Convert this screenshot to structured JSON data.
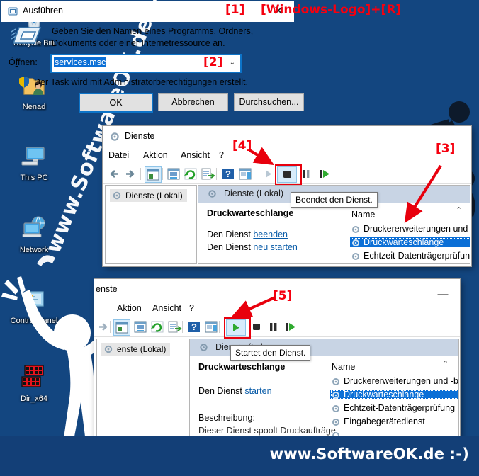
{
  "desktop": {
    "background_color": "#134680",
    "watermark": "www.SoftwareOK.de :-)",
    "icons": [
      {
        "name": "Recycle Bin",
        "icon": "recycle-bin-icon"
      },
      {
        "name": "Nenad",
        "icon": "user-folder-icon"
      },
      {
        "name": "This PC",
        "icon": "this-pc-icon"
      },
      {
        "name": "Network",
        "icon": "network-icon"
      },
      {
        "name": "Control Panel",
        "icon": "control-panel-icon"
      },
      {
        "name": "Dir_x64",
        "icon": "dir-x64-icon"
      }
    ]
  },
  "banner": {
    "url": "www.SoftwareOK.de :-)"
  },
  "steps": {
    "s1": "[1]",
    "s2": "[2]",
    "s3": "[3]",
    "s4": "[4]",
    "s5": "[5]"
  },
  "run_dialog": {
    "title": "Ausführen",
    "hint": "[Windows-Logo]+[R]",
    "description_line1": "Geben Sie den Namen eines Programms, Ordners,",
    "description_line2": "Dokuments oder einer Internetressource an.",
    "open_label": "Öffnen:",
    "open_value": "services.msc",
    "uac_text": "Der Task wird mit Administratorberechtigungen erstellt.",
    "buttons": {
      "ok": "OK",
      "cancel": "Abbrechen",
      "browse": "Durchsuchen..."
    },
    "close_glyph": "✕",
    "chevron_glyph": "⌄"
  },
  "services_top": {
    "title": "Dienste",
    "menu": [
      "Datei",
      "Aktion",
      "Ansicht",
      "?"
    ],
    "tree_node": "Dienste (Lokal)",
    "pane_header": "Dienste (Lokal)",
    "service_name": "Druckwarteschlange",
    "action_stop_prefix": "Den Dienst ",
    "action_stop_link": "beenden",
    "action_restart_prefix": "Den Dienst ",
    "action_restart_link": "neu starten",
    "tooltip": "Beendet den Dienst.",
    "column_name": "Name",
    "rows": [
      {
        "label": "Druckererweiterungen und -b",
        "selected": false
      },
      {
        "label": "Druckwarteschlange",
        "selected": true
      },
      {
        "label": "Echtzeit-Datenträgerprüfung",
        "selected": false
      }
    ],
    "toolbar_icons": [
      "back-icon",
      "forward-icon",
      "show-hide-tree-icon",
      "properties-icon",
      "refresh-icon",
      "export-list-icon",
      "help-icon",
      "show-action-pane-icon",
      "start-service-icon",
      "stop-service-icon",
      "pause-service-icon",
      "restart-service-icon"
    ],
    "highlighted_toolbar_button": "stop-service-icon"
  },
  "services_bottom": {
    "title": "enste",
    "menu": [
      "Aktion",
      "Ansicht",
      "?"
    ],
    "tree_node": "enste (Lokal)",
    "pane_header": "Dienste (Lok",
    "service_name": "Druckwarteschlange",
    "action_start_prefix": "Den Dienst ",
    "action_start_link": "starten",
    "description_label": "Beschreibung:",
    "description_text": "Dieser Dienst spoolt Druckaufträge",
    "tooltip": "Startet den Dienst.",
    "column_name": "Name",
    "minimize_glyph": "—",
    "rows": [
      {
        "label": "Druckererweiterungen und -benachrich",
        "selected": false
      },
      {
        "label": "Druckwarteschlange",
        "selected": true
      },
      {
        "label": "Echtzeit-Datenträgerprüfung",
        "selected": false
      },
      {
        "label": "Eingabegerätedienst",
        "selected": false
      }
    ],
    "toolbar_icons": [
      "show-hide-tree-icon",
      "properties-icon",
      "refresh-icon",
      "export-list-icon",
      "help-icon",
      "show-action-pane-icon",
      "start-service-icon",
      "stop-service-icon",
      "pause-service-icon",
      "restart-service-icon"
    ],
    "highlighted_toolbar_button": "start-service-icon"
  },
  "colors": {
    "accent_red": "#f5000f",
    "selection_blue": "#0b6fd6",
    "desktop_blue": "#134680",
    "banner_blue": "#133f77"
  }
}
